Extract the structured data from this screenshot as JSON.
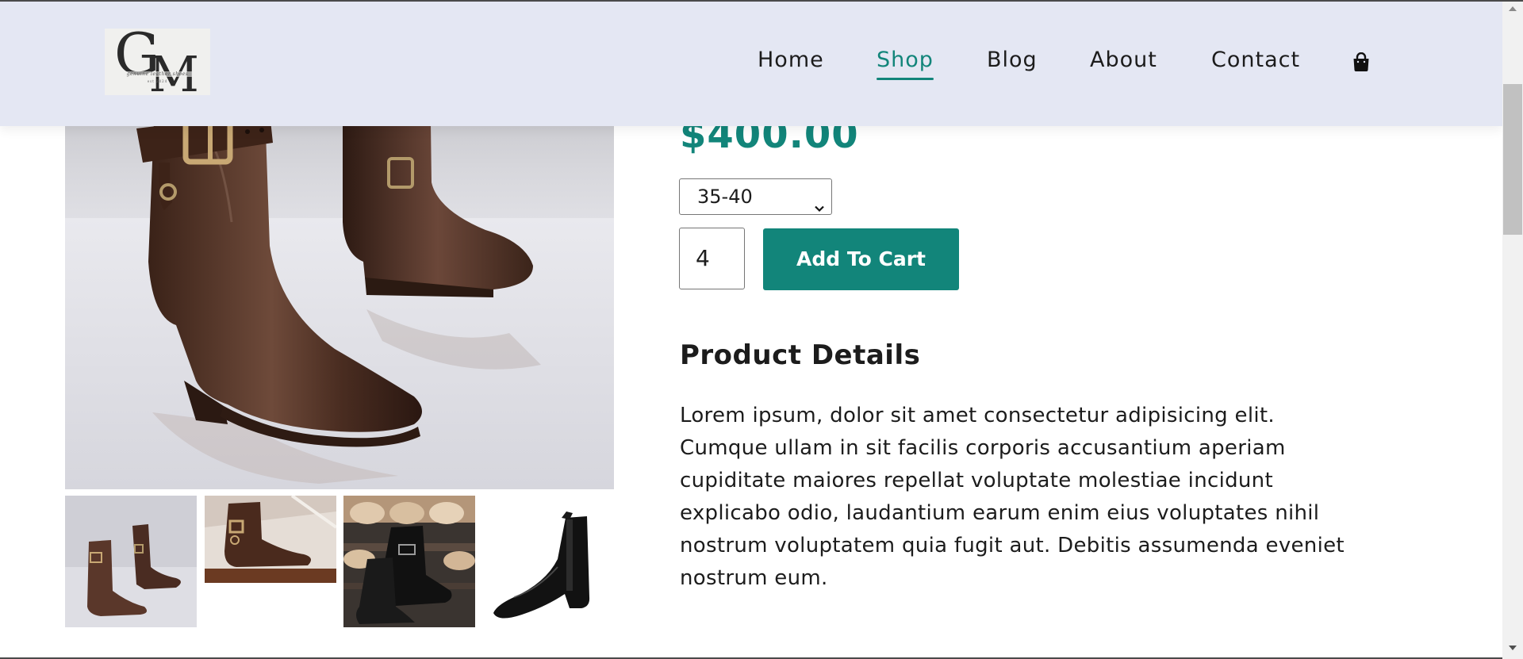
{
  "header": {
    "logo": {
      "monogram_g": "G",
      "monogram_m": "M",
      "tagline": "genuine leather shoes",
      "subline": "est 2024"
    },
    "nav": [
      {
        "label": "Home",
        "active": false
      },
      {
        "label": "Shop",
        "active": true
      },
      {
        "label": "Blog",
        "active": false
      },
      {
        "label": "About",
        "active": false
      },
      {
        "label": "Contact",
        "active": false
      }
    ],
    "cart_icon": "shopping-bag-icon"
  },
  "product": {
    "price": "$400.00",
    "size": {
      "selected": "35-40"
    },
    "quantity": "4",
    "add_to_cart_label": "Add To Cart",
    "details_title": "Product Details",
    "details_lines": [
      "Lorem ipsum, dolor sit amet consectetur adipisicing elit.",
      "Cumque ullam in sit facilis corporis accusantium aperiam",
      "cupiditate maiores repellat voluptate molestiae incidunt",
      "explicabo odio, laudantium earum enim eius voluptates nihil",
      "nostrum voluptatem quia fugit aut. Debitis assumenda eveniet",
      "nostrum eum."
    ]
  },
  "gallery": {
    "thumbnails": [
      {
        "name": "brown-strap-boots-pair"
      },
      {
        "name": "brown-strap-boot-side"
      },
      {
        "name": "black-boot-on-rack"
      },
      {
        "name": "black-chelsea-boot"
      }
    ]
  },
  "colors": {
    "accent": "#12857a",
    "header_bg": "#e4e7f3",
    "text": "#1c1c1c"
  }
}
